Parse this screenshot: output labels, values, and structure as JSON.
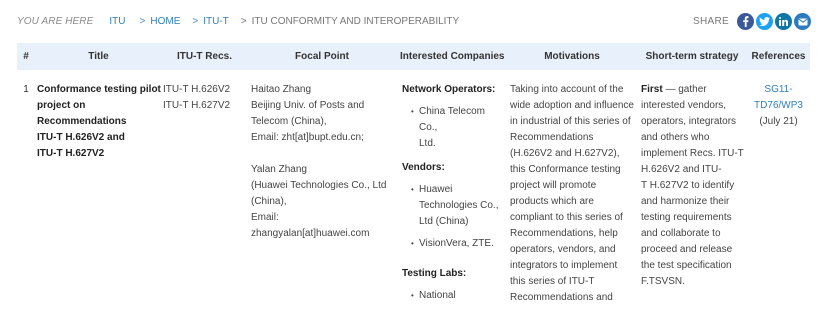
{
  "breadcrumb": {
    "you_are_here": "YOU ARE HERE",
    "items": [
      {
        "label": "ITU"
      },
      {
        "prefix": ">",
        "label": "HOME"
      },
      {
        "prefix": ">",
        "label": "ITU-T"
      },
      {
        "prefix": ">",
        "label": "ITU CONFORMITY AND INTEROPERABILITY"
      }
    ]
  },
  "share": {
    "label": "SHARE",
    "icons": [
      {
        "name": "facebook-icon",
        "color": "#3b5998"
      },
      {
        "name": "twitter-icon",
        "color": "#1da1f2"
      },
      {
        "name": "linkedin-icon",
        "color": "#0e76a8"
      },
      {
        "name": "email-icon",
        "color": "#2c7bbf"
      }
    ]
  },
  "table": {
    "headers": [
      "#",
      "Title",
      "ITU-T Recs.",
      "Focal Point",
      "Interested Companies",
      "Motivations",
      "Short-term strategy",
      "References"
    ],
    "row": {
      "num": "1",
      "title_lines": [
        "Conformance testing pilot",
        "project on",
        "Recommendations",
        "ITU-T H.626V2 and",
        "ITU-T H.627V2"
      ],
      "recs": [
        "ITU-T H.626V2",
        "ITU-T H.627V2"
      ],
      "focal_a": [
        "Haitao Zhang",
        "Beijing Univ. of Posts and",
        "Telecom (China),",
        "Email: zht[at]bupt.edu.cn;"
      ],
      "focal_b": [
        "Yalan Zhang",
        "(Huawei Technologies Co., Ltd",
        "(China),",
        "Email: zhangyalan[at]huawei.com"
      ],
      "companies": [
        {
          "group": "Network Operators:",
          "items": [
            [
              "China Telecom Co.,",
              "Ltd."
            ]
          ]
        },
        {
          "group": "Vendors:",
          "items": [
            [
              "Huawei",
              "Technologies Co.,",
              "Ltd (China)"
            ],
            [
              "VisionVera, ZTE."
            ]
          ]
        },
        {
          "group": "Testing Labs:",
          "items": [
            [
              "National"
            ]
          ]
        }
      ],
      "motivations": [
        "Taking into account of the",
        "wide adoption and influence",
        "in industrial of this series of",
        "Recommendations",
        "(H.626V2 and H.627V2),",
        "this Conformance testing",
        "project will promote",
        "products which are",
        "compliant to this series of",
        "Recommendations, help",
        "operators, vendors, and",
        "integrators to implement",
        "this series of ITU-T",
        "Recommendations and"
      ],
      "strategy_first": "First",
      "strategy_lines": [
        " — gather",
        "interested vendors,",
        "operators, integrators",
        "and others who",
        "implement Recs. ITU-T",
        "H.626V2 and ITU-",
        "T H.627V2 to identify",
        "and harmonize their",
        "testing requirements",
        "and collaborate to",
        "proceed and release",
        "the test specification",
        "F.TSVSN."
      ],
      "reference_link": [
        "SG11-",
        "TD76/WP3"
      ],
      "reference_date": "(July 21)"
    }
  }
}
